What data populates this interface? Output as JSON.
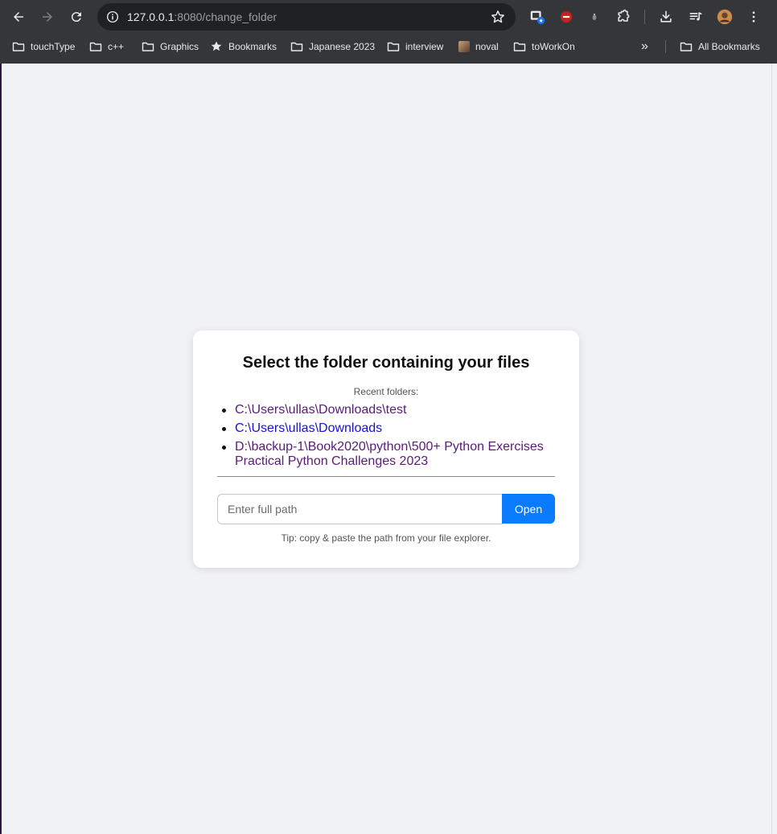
{
  "browser": {
    "url_host": "127.0.0.1",
    "url_rest": ":8080/change_folder",
    "bookmarks": [
      {
        "label": "touchType",
        "icon": "folder-icon"
      },
      {
        "label": "c++",
        "icon": "folder-icon"
      },
      {
        "label": "Graphics",
        "icon": "folder-icon"
      },
      {
        "label": "Bookmarks",
        "icon": "star-icon"
      },
      {
        "label": "Japanese 2023",
        "icon": "folder-icon"
      },
      {
        "label": "interview",
        "icon": "folder-icon"
      },
      {
        "label": "noval",
        "icon": "avatar-icon"
      },
      {
        "label": "toWorkOn",
        "icon": "folder-icon"
      }
    ],
    "overflow_label": "»",
    "all_bookmarks_label": "All Bookmarks"
  },
  "page": {
    "title": "Select the folder containing your files",
    "recent_label": "Recent folders:",
    "recent_folders": [
      {
        "path": "C:\\Users\\ullas\\Downloads\\test",
        "visited": true
      },
      {
        "path": "C:\\Users\\ullas\\Downloads",
        "visited": false
      },
      {
        "path": "D:\\backup-1\\Book2020\\python\\500+ Python Exercises Practical Python Challenges 2023",
        "visited": true
      }
    ],
    "input_placeholder": "Enter full path",
    "open_label": "Open",
    "tip": "Tip: copy & paste the path from your file explorer."
  },
  "colors": {
    "accent": "#0a7bff",
    "visited_link": "#5a1a7a",
    "unvisited_link": "#1a10d6"
  }
}
